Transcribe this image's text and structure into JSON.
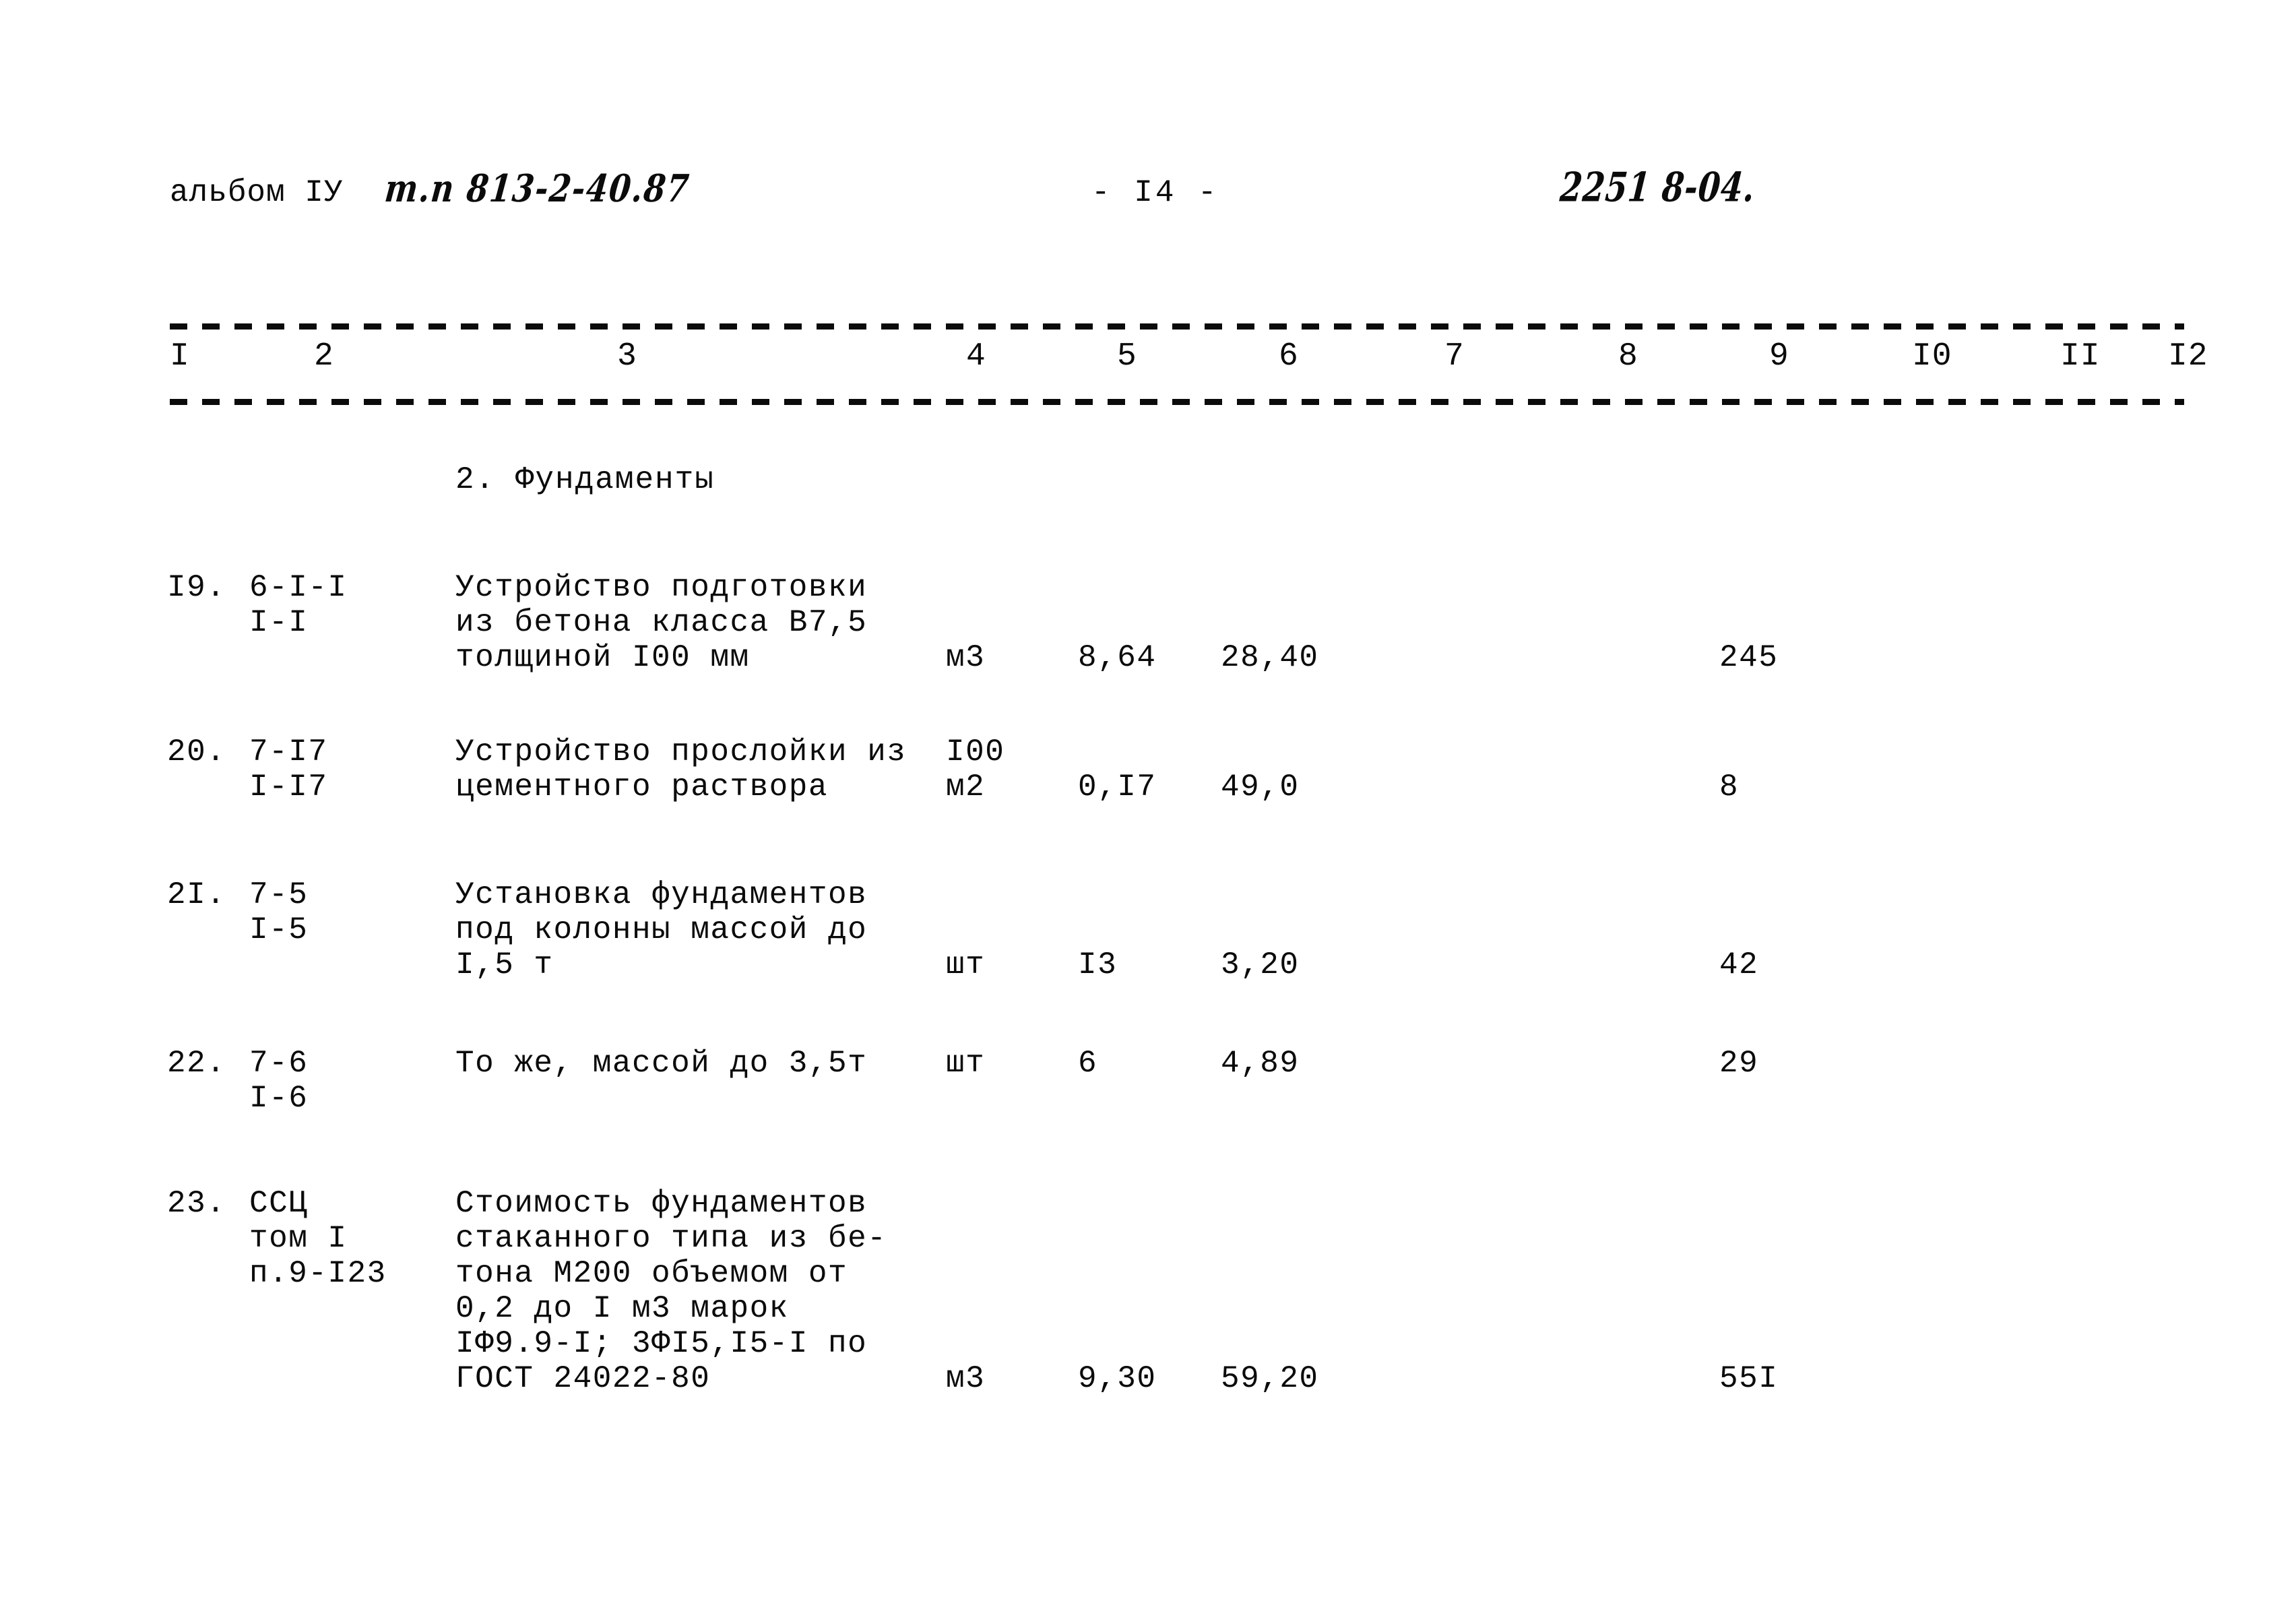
{
  "header": {
    "album_label": "альбом IУ",
    "album_code_handwritten": "т.п 813-2-40.87",
    "page_number": "- I4 -",
    "doc_number_handwritten": "2251 8-04."
  },
  "table": {
    "column_headers": [
      "I",
      "2",
      "3",
      "4",
      "5",
      "6",
      "7",
      "8",
      "9",
      "I0",
      "II",
      "I2"
    ],
    "section_title": "2. Фундаменты",
    "rows": [
      {
        "num": "I9.",
        "code_line1": "6-I-I",
        "code_line2": "I-I",
        "desc_line1": "Устройство подготовки",
        "desc_line2": "из бетона класса В7,5",
        "desc_line3": "толщиной I00 мм",
        "unit": "м3",
        "qty": "8,64",
        "price": "28,40",
        "total": "245"
      },
      {
        "num": "20.",
        "code_line1": "7-I7",
        "code_line2": "I-I7",
        "desc_line1": "Устройство прослойки из",
        "desc_line2": "цементного раствора",
        "inline_top": "I00",
        "unit": "м2",
        "qty": "0,I7",
        "price": "49,0",
        "total": "8"
      },
      {
        "num": "2I.",
        "code_line1": "7-5",
        "code_line2": "I-5",
        "desc_line1": "Установка фундаментов",
        "desc_line2": "под колонны массой до",
        "desc_line3": "I,5 т",
        "unit": "шт",
        "qty": "I3",
        "price": "3,20",
        "total": "42"
      },
      {
        "num": "22.",
        "code_line1": "7-6",
        "code_line2": "I-6",
        "desc_line1": "То же, массой до 3,5т",
        "unit": "шт",
        "qty": "6",
        "price": "4,89",
        "total": "29"
      },
      {
        "num": "23.",
        "code_line1": "ССЦ",
        "code_line2": "том I",
        "code_line3": "п.9-I23",
        "desc_line1": "Стоимость фундаментов",
        "desc_line2": "стаканного типа из бе-",
        "desc_line3": "тона М200 объемом от",
        "desc_line4": "0,2 до I м3 марок",
        "desc_line5": "IФ9.9-I; 3ФI5,I5-I по",
        "desc_line6": "ГОСТ 24022-80",
        "unit": "м3",
        "qty": "9,30",
        "price": "59,20",
        "total": "55I"
      }
    ]
  }
}
